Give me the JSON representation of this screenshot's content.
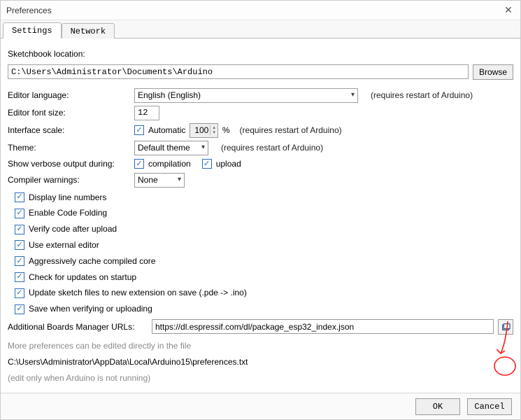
{
  "window": {
    "title": "Preferences"
  },
  "tabs": {
    "settings": "Settings",
    "network": "Network"
  },
  "sketchbook": {
    "label": "Sketchbook location:",
    "path": "C:\\Users\\Administrator\\Documents\\Arduino",
    "browse": "Browse"
  },
  "editor_language": {
    "label": "Editor language:",
    "value": "English (English)",
    "hint": "(requires restart of Arduino)"
  },
  "editor_font_size": {
    "label": "Editor font size:",
    "value": "12"
  },
  "interface_scale": {
    "label": "Interface scale:",
    "automatic_label": "Automatic",
    "automatic_checked": true,
    "value": "100",
    "pct": "%",
    "hint": "(requires restart of Arduino)"
  },
  "theme": {
    "label": "Theme:",
    "value": "Default theme",
    "hint": "(requires restart of Arduino)"
  },
  "verbose": {
    "label": "Show verbose output during:",
    "compilation_label": "compilation",
    "upload_label": "upload",
    "compilation_checked": true,
    "upload_checked": true
  },
  "compiler_warnings": {
    "label": "Compiler warnings:",
    "value": "None"
  },
  "checkboxes": {
    "display_line_numbers": {
      "label": "Display line numbers",
      "checked": true
    },
    "enable_code_folding": {
      "label": "Enable Code Folding",
      "checked": true
    },
    "verify_code_after_upload": {
      "label": "Verify code after upload",
      "checked": true
    },
    "use_external_editor": {
      "label": "Use external editor",
      "checked": true
    },
    "aggr_cache": {
      "label": "Aggressively cache compiled core",
      "checked": true
    },
    "check_updates": {
      "label": "Check for updates on startup",
      "checked": true
    },
    "update_sketch_ext": {
      "label": "Update sketch files to new extension on save (.pde -> .ino)",
      "checked": true
    },
    "save_when_verify": {
      "label": "Save when verifying or uploading",
      "checked": true
    }
  },
  "boards_urls": {
    "label": "Additional Boards Manager URLs:",
    "value": "https://dl.espressif.com/dl/package_esp32_index.json"
  },
  "footnote_1": "More preferences can be edited directly in the file",
  "footnote_path": "C:\\Users\\Administrator\\AppData\\Local\\Arduino15\\preferences.txt",
  "footnote_3": "(edit only when Arduino is not running)",
  "buttons": {
    "ok": "OK",
    "cancel": "Cancel"
  }
}
